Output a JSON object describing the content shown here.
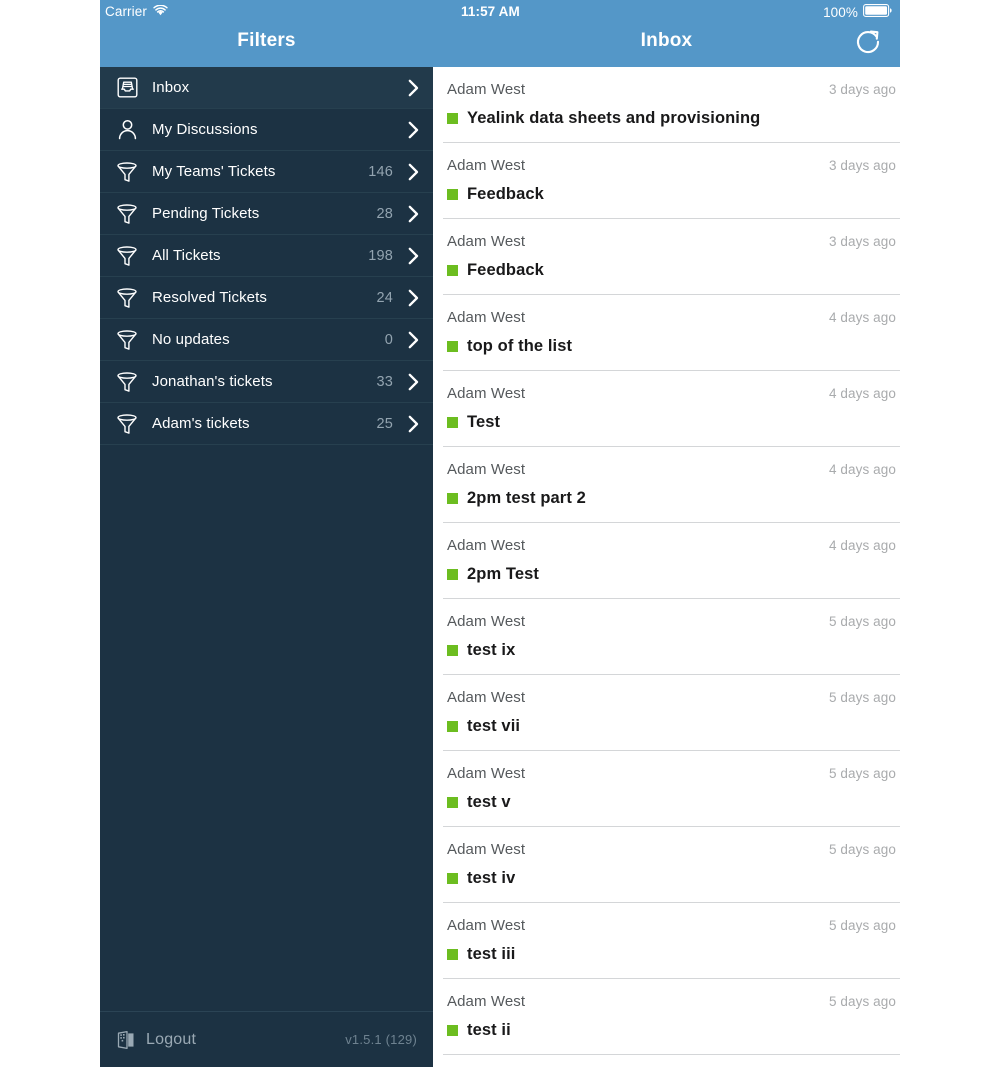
{
  "status_bar": {
    "carrier": "Carrier",
    "wifi_icon": "wifi-icon",
    "time": "11:57 AM",
    "battery_percent": "100%",
    "battery_icon": "battery-full-icon"
  },
  "sidebar": {
    "title": "Filters",
    "items": [
      {
        "label": "Inbox",
        "count": "",
        "icon": "inbox-tray-icon",
        "selected": true
      },
      {
        "label": "My Discussions",
        "count": "",
        "icon": "person-icon",
        "selected": false
      },
      {
        "label": "My Teams' Tickets",
        "count": "146",
        "icon": "funnel-icon",
        "selected": false
      },
      {
        "label": "Pending Tickets",
        "count": "28",
        "icon": "funnel-icon",
        "selected": false
      },
      {
        "label": "All Tickets",
        "count": "198",
        "icon": "funnel-icon",
        "selected": false
      },
      {
        "label": "Resolved Tickets",
        "count": "24",
        "icon": "funnel-icon",
        "selected": false
      },
      {
        "label": "No updates",
        "count": "0",
        "icon": "funnel-icon",
        "selected": false
      },
      {
        "label": "Jonathan's tickets",
        "count": "33",
        "icon": "funnel-icon",
        "selected": false
      },
      {
        "label": "Adam's tickets",
        "count": "25",
        "icon": "funnel-icon",
        "selected": false
      }
    ],
    "footer": {
      "logout_label": "Logout",
      "logout_icon": "logout-door-icon",
      "version": "v1.5.1 (129)"
    }
  },
  "content": {
    "title": "Inbox",
    "refresh_icon": "refresh-icon",
    "tickets": [
      {
        "sender": "Adam West",
        "time": "3 days ago",
        "subject": "Yealink data sheets and provisioning",
        "status_color": "#6cbd20"
      },
      {
        "sender": "Adam West",
        "time": "3 days ago",
        "subject": "Feedback",
        "status_color": "#6cbd20"
      },
      {
        "sender": "Adam West",
        "time": "3 days ago",
        "subject": "Feedback",
        "status_color": "#6cbd20"
      },
      {
        "sender": "Adam West",
        "time": "4 days ago",
        "subject": "top of the list",
        "status_color": "#6cbd20"
      },
      {
        "sender": "Adam West",
        "time": "4 days ago",
        "subject": "Test",
        "status_color": "#6cbd20"
      },
      {
        "sender": "Adam West",
        "time": "4 days ago",
        "subject": "2pm test part 2",
        "status_color": "#6cbd20"
      },
      {
        "sender": "Adam West",
        "time": "4 days ago",
        "subject": "2pm Test",
        "status_color": "#6cbd20"
      },
      {
        "sender": "Adam West",
        "time": "5 days ago",
        "subject": "test ix",
        "status_color": "#6cbd20"
      },
      {
        "sender": "Adam West",
        "time": "5 days ago",
        "subject": "test vii",
        "status_color": "#6cbd20"
      },
      {
        "sender": "Adam West",
        "time": "5 days ago",
        "subject": "test v",
        "status_color": "#6cbd20"
      },
      {
        "sender": "Adam West",
        "time": "5 days ago",
        "subject": "test iv",
        "status_color": "#6cbd20"
      },
      {
        "sender": "Adam West",
        "time": "5 days ago",
        "subject": "test iii",
        "status_color": "#6cbd20"
      },
      {
        "sender": "Adam West",
        "time": "5 days ago",
        "subject": "test ii",
        "status_color": "#6cbd20"
      }
    ]
  },
  "colors": {
    "header_blue": "#5497c8",
    "sidebar_navy": "#1c3243",
    "status_green": "#6cbd20",
    "separator": "#d4d6d8"
  }
}
